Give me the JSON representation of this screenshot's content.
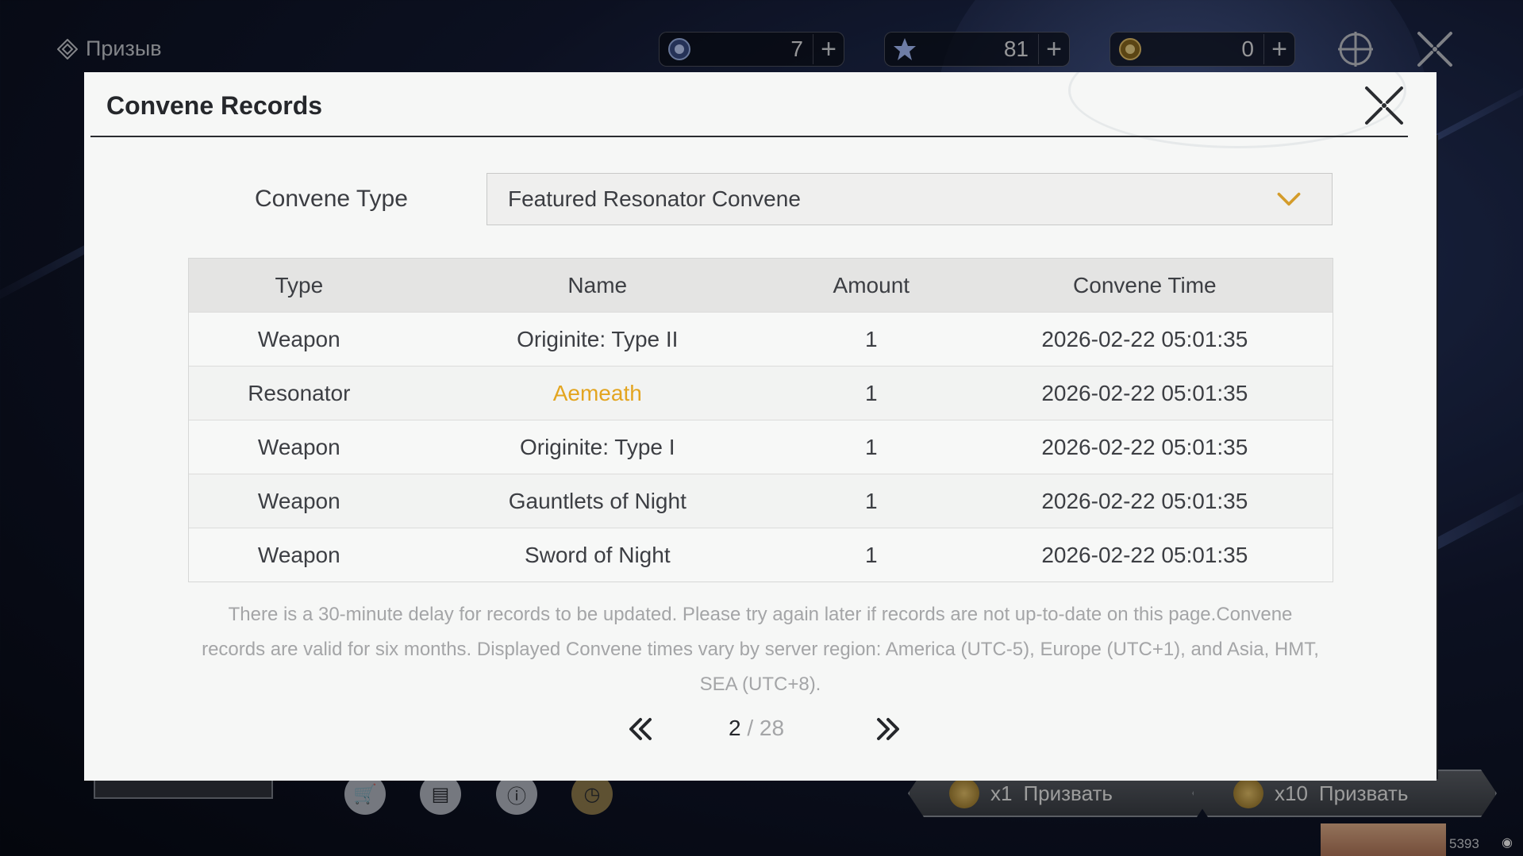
{
  "header": {
    "summon_label": "Призыв",
    "currencies": [
      {
        "icon": "astrite-icon",
        "value": "7"
      },
      {
        "icon": "star-icon",
        "value": "81"
      },
      {
        "icon": "lustrous-tide-icon",
        "value": "0"
      }
    ]
  },
  "bottom": {
    "summon_x1_count": "x1",
    "summon_x1_label": "Призвать",
    "summon_x10_count": "x10",
    "summon_x10_label": "Призвать",
    "uid_fragment": "5393"
  },
  "modal": {
    "title": "Convene Records",
    "convene_type_label": "Convene Type",
    "convene_type_value": "Featured Resonator Convene",
    "columns": [
      "Type",
      "Name",
      "Amount",
      "Convene Time"
    ],
    "rows": [
      {
        "type": "Weapon",
        "name": "Originite: Type II",
        "amount": "1",
        "time": "2026-02-22 05:01:35",
        "highlight": false
      },
      {
        "type": "Resonator",
        "name": "Aemeath",
        "amount": "1",
        "time": "2026-02-22 05:01:35",
        "highlight": true
      },
      {
        "type": "Weapon",
        "name": "Originite: Type I",
        "amount": "1",
        "time": "2026-02-22 05:01:35",
        "highlight": false
      },
      {
        "type": "Weapon",
        "name": "Gauntlets of Night",
        "amount": "1",
        "time": "2026-02-22 05:01:35",
        "highlight": false
      },
      {
        "type": "Weapon",
        "name": "Sword of Night",
        "amount": "1",
        "time": "2026-02-22 05:01:35",
        "highlight": false
      }
    ],
    "note": "There is a 30-minute delay for records to be updated. Please try again later if records are not up-to-date on this page.Convene records are valid for six months. Displayed Convene times vary by server region: America (UTC-5), Europe (UTC+1), and Asia, HMT, SEA (UTC+8).",
    "pager": {
      "current": "2",
      "separator": " / ",
      "total": "28"
    }
  },
  "colors": {
    "highlight_gold": "#e3a520",
    "modal_bg": "#f6f7f6",
    "header_row_bg": "#e4e4e3"
  }
}
